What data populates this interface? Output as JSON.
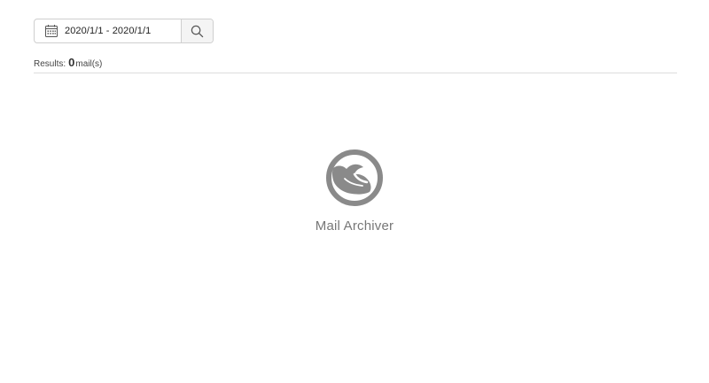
{
  "search": {
    "date_range": "2020/1/1 - 2020/1/1",
    "calendar_icon": "calendar-icon",
    "search_icon": "search-icon"
  },
  "results": {
    "label": "Results:",
    "count": "0",
    "unit": "mail(s)"
  },
  "empty_state": {
    "logo_icon": "mail-archiver-logo",
    "app_name": "Mail Archiver"
  },
  "colors": {
    "logo": "#8a8a8a",
    "border": "#cfcfcf",
    "divider": "#dcdcdc",
    "button_bg": "#f4f4f4"
  }
}
